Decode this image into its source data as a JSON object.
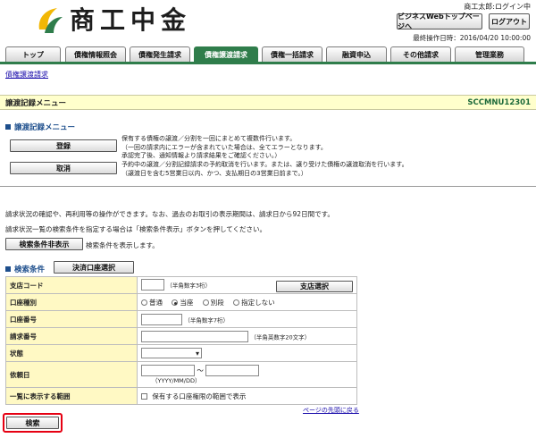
{
  "header": {
    "logo_text": "商工中金",
    "user_name": "商工太郎:ログイン中",
    "web_top_button": "ビジネスWebトップページへ",
    "logout_button": "ログアウト",
    "last_operation": "最終操作日時：2016/04/20 10:00:00"
  },
  "tabs": [
    {
      "label": "トップ"
    },
    {
      "label": "債権情報照会"
    },
    {
      "label": "債権発生請求"
    },
    {
      "label": "債権譲渡請求"
    },
    {
      "label": "債権一括請求"
    },
    {
      "label": "融資申込"
    },
    {
      "label": "その他請求"
    },
    {
      "label": "管理業務"
    }
  ],
  "active_tab": "債権譲渡請求",
  "breadcrumb": "債権譲渡請求",
  "page_title": "譲渡記録メニュー",
  "screen_id": "SCCMNU12301",
  "menu_section": {
    "heading": "譲渡記録メニュー",
    "register_button": "登録",
    "register_desc": [
      "保有する債権の譲渡／分割を一回にまとめて複数件行います。",
      "（一回の請求内にエラーが含まれていた場合は、全てエラーとなります。",
      "承認完了後、通知情報より請求結果をご確認ください。）"
    ],
    "cancel_button": "取消",
    "cancel_desc": [
      "予約中の譲渡／分割記録請求の予約取消を行います。または、譲り受けた債権の譲渡取消を行います。",
      "（譲渡日を含む5営業日以内、かつ、支払期日の3営業日前まで。）"
    ]
  },
  "info_lines": [
    "請求状況の確認や、再利用等の操作ができます。なお、過去のお取引の表示期間は、請求日から92日間です。",
    "請求状況一覧の検索条件を指定する場合は「検索条件表示」ボタンを押してください。"
  ],
  "search_toggle": {
    "button": "検索条件非表示",
    "desc": "検索条件を表示します。"
  },
  "search_section": {
    "heading": "検索条件",
    "account_select_button": "決済口座選択",
    "rows": {
      "branch_code": {
        "label": "支店コード",
        "hint": "（半角数字3桁）",
        "button": "支店選択"
      },
      "account_type": {
        "label": "口座種別",
        "options": [
          "普通",
          "当座",
          "別段",
          "指定しない"
        ],
        "selected": "当座"
      },
      "account_number": {
        "label": "口座番号",
        "hint": "（半角数字7桁）"
      },
      "request_number": {
        "label": "請求番号",
        "hint": "（半角英数字20文字）"
      },
      "status": {
        "label": "状態",
        "value": ""
      },
      "request_date": {
        "label": "依頼日",
        "separator": "〜",
        "hint": "（YYYY/MM/DD）"
      },
      "display_range": {
        "label": "一覧に表示する範囲",
        "checkbox_label": "保有する口座権限の範囲で表示"
      }
    }
  },
  "back_to_top": "ページの先頭に戻る",
  "search_button": "検索",
  "colors": {
    "tab_active": "#2f7d4b",
    "title_bar": "#ffffcc",
    "label_cell": "#fff9c4",
    "highlight": "#e60012",
    "logo_yellow": "#f2b705",
    "logo_green": "#2f7d4b"
  }
}
